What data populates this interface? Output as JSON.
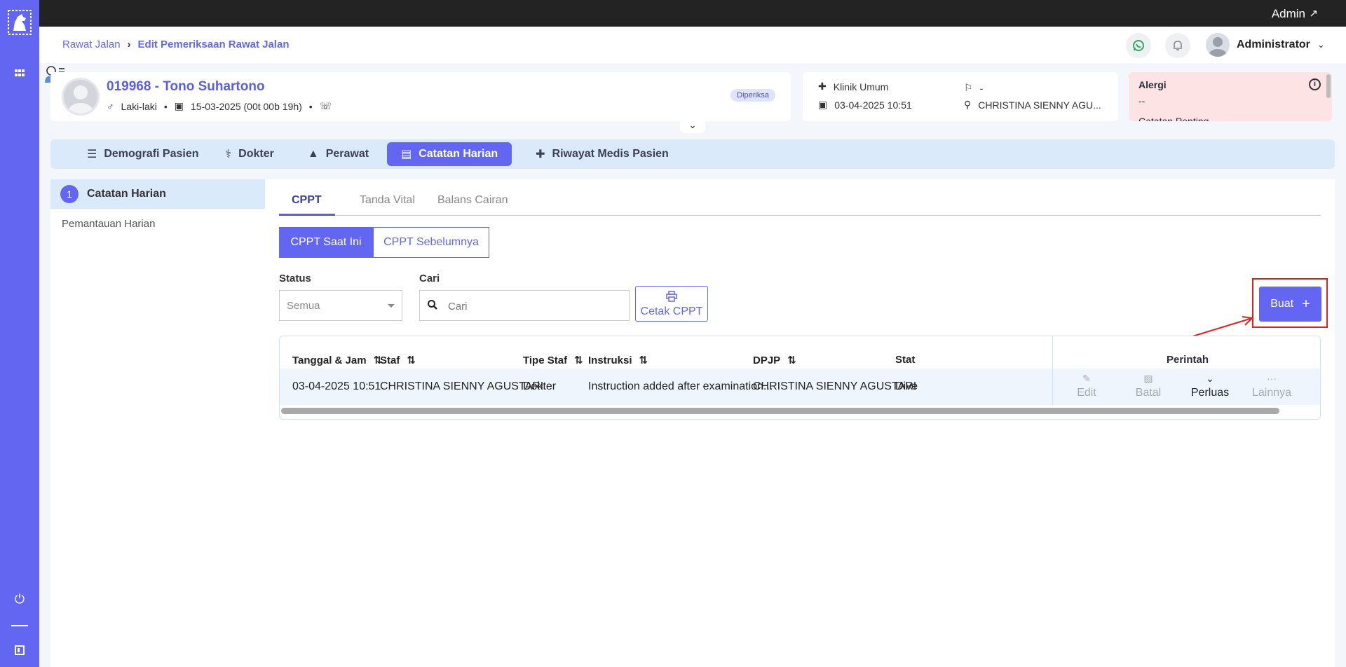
{
  "topbar": {
    "user_label": "Admin"
  },
  "header": {
    "breadcrumb": [
      "Rawat Jalan",
      "Edit Pemeriksaan Rawat Jalan"
    ],
    "user_name": "Administrator"
  },
  "patient": {
    "title": "019968 - Tono Suhartono",
    "gender": "Laki-laki",
    "dob": "15-03-2025 (00t 00b 19h)",
    "status": "Diperiksa"
  },
  "visit": {
    "clinic": "Klinik Umum",
    "datetime": "03-04-2025 10:51",
    "flag": "-",
    "doctor": "CHRISTINA SIENNY AGU..."
  },
  "alert": {
    "title": "Alergi",
    "value": "--",
    "extra": "Catatan Penting"
  },
  "tabs": [
    {
      "label": "Demografi Pasien"
    },
    {
      "label": "Dokter"
    },
    {
      "label": "Perawat"
    },
    {
      "label": "Catatan Harian"
    },
    {
      "label": "Riwayat Medis Pasien"
    }
  ],
  "left_panel": {
    "step": "1",
    "active": "Catatan Harian",
    "item": "Pemantauan Harian"
  },
  "subtabs": [
    "CPPT",
    "Tanda Vital",
    "Balans Cairan"
  ],
  "toggles": [
    "CPPT Saat Ini",
    "CPPT Sebelumnya"
  ],
  "filters": {
    "status_label": "Status",
    "status_value": "Semua",
    "search_label": "Cari",
    "search_placeholder": "Cari",
    "print_label": "Cetak CPPT",
    "create_label": "Buat"
  },
  "table": {
    "headers": [
      "Tanggal & Jam",
      "Staf",
      "Tipe Staf",
      "Instruksi",
      "DPJP",
      "Stat",
      "Perintah"
    ],
    "row": {
      "datetime": "03-04-2025 10:51",
      "staff": "CHRISTINA SIENNY AGUSTARI",
      "type": "Dokter",
      "instruction": "Instruction added after examination...",
      "dpjp": "CHRISTINA SIENNY AGUSTARI",
      "status": "Dive"
    },
    "actions": [
      "Edit",
      "Batal",
      "Perluas",
      "Lainnya"
    ]
  },
  "colors": {
    "accent": "#6366f1",
    "alert_bg": "#fde3e3",
    "highlight": "#e02020"
  }
}
